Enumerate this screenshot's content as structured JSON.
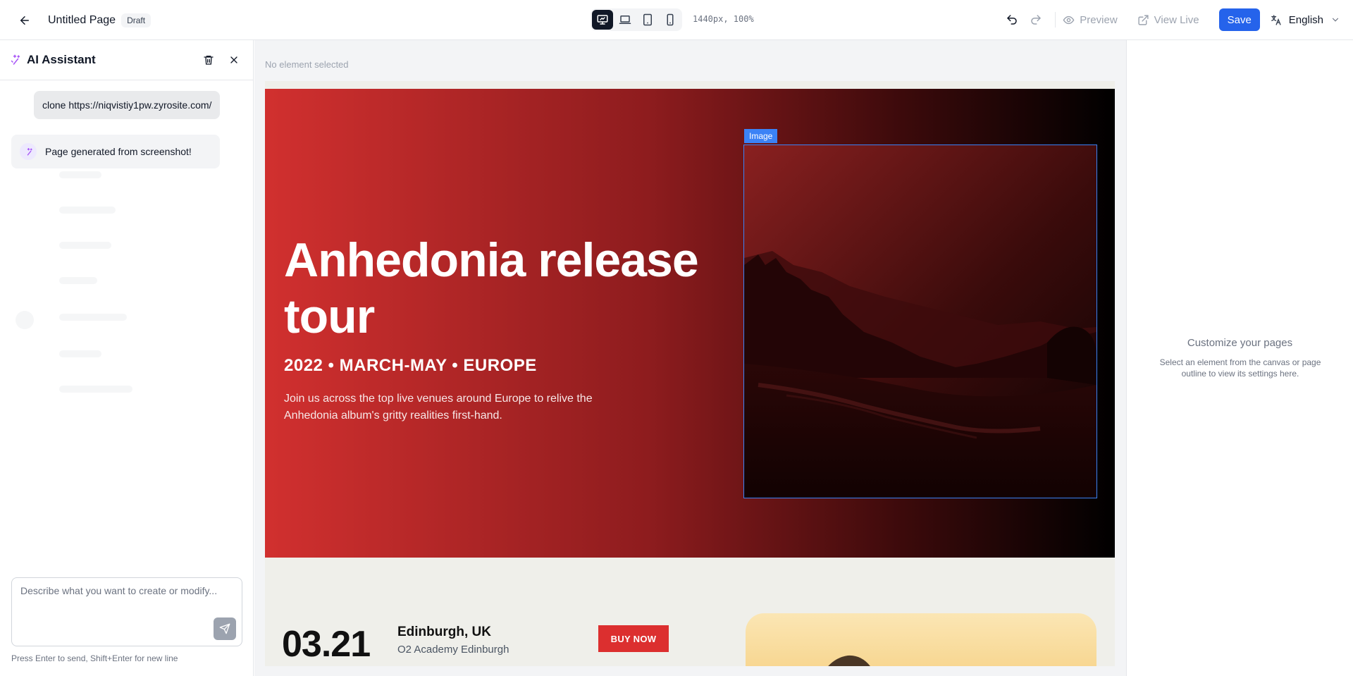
{
  "topbar": {
    "page_title": "Untitled Page",
    "status_badge": "Draft",
    "viewport_readout": "1440px, 100%",
    "preview_label": "Preview",
    "view_live_label": "View Live",
    "save_label": "Save",
    "language": "English",
    "devices": [
      "desktop",
      "laptop",
      "tablet",
      "mobile"
    ],
    "active_device": "desktop"
  },
  "assistant": {
    "title": "AI Assistant",
    "user_message": "clone https://niqvistiy1pw.zyrosite.com/",
    "bot_message": "Page generated from screenshot!",
    "input_placeholder": "Describe what you want to create or modify...",
    "hint": "Press Enter to send, Shift+Enter for new line"
  },
  "canvas": {
    "selection_status": "No element selected",
    "selected_tag": "Image",
    "hero": {
      "title": "Anhedonia release tour",
      "subtitle": "2022 • MARCH-MAY • EUROPE",
      "description": "Join us across the top live venues around Europe to relive the Anhedonia album's gritty realities first-hand."
    },
    "tour": {
      "date": "03.21",
      "city": "Edinburgh, UK",
      "venue": "O2 Academy Edinburgh",
      "button": "BUY NOW"
    }
  },
  "settings_panel": {
    "title": "Customize your pages",
    "description": "Select an element from the canvas or page outline to view its settings here."
  },
  "colors": {
    "accent": "#2563eb",
    "hero_red": "#d1302f",
    "buy_button": "#dc2f2f",
    "selection_outline": "#3b82f6"
  }
}
